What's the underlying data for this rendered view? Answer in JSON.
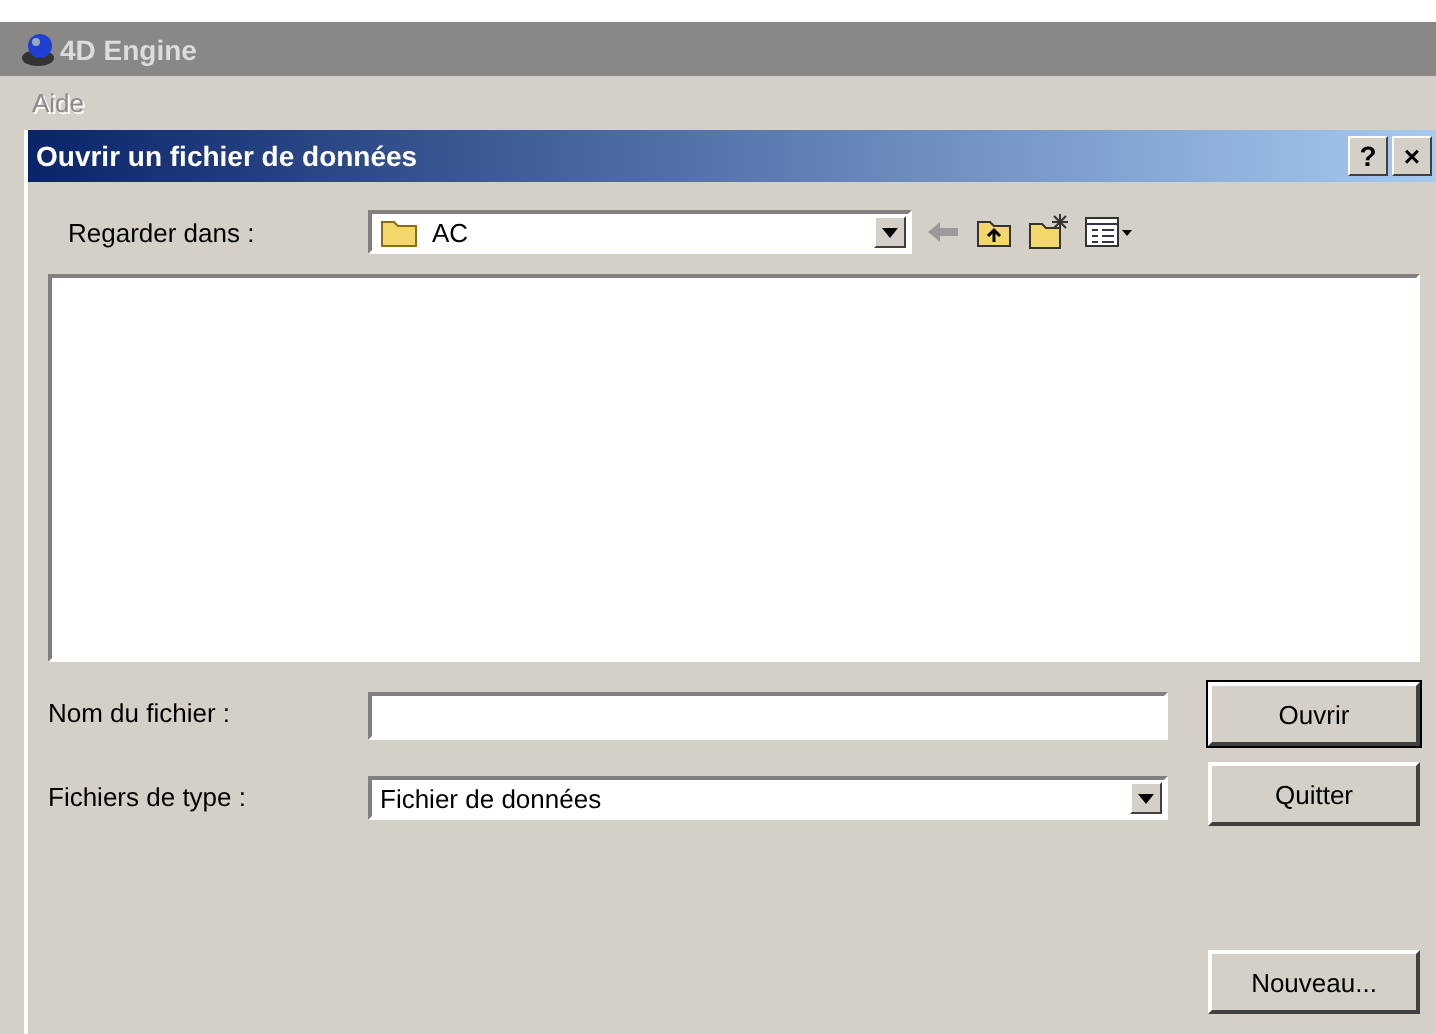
{
  "app_window": {
    "title": "4D Engine",
    "menu": [
      {
        "label": "Aide",
        "disabled": true
      }
    ]
  },
  "dialog": {
    "title": "Ouvrir un fichier de données",
    "title_buttons": [
      "?",
      "×"
    ],
    "look_in": {
      "label": "Regarder dans :",
      "value": "AC"
    },
    "file_name": {
      "label": "Nom du fichier :"
    },
    "file_type": {
      "label": "Fichiers de type :",
      "value": "Fichier de données"
    },
    "buttons": [
      {
        "label": "Ouvrir",
        "default": true
      },
      {
        "label": "Quitter",
        "default": false
      },
      {
        "label": "Nouveau...",
        "default": false
      }
    ]
  }
}
